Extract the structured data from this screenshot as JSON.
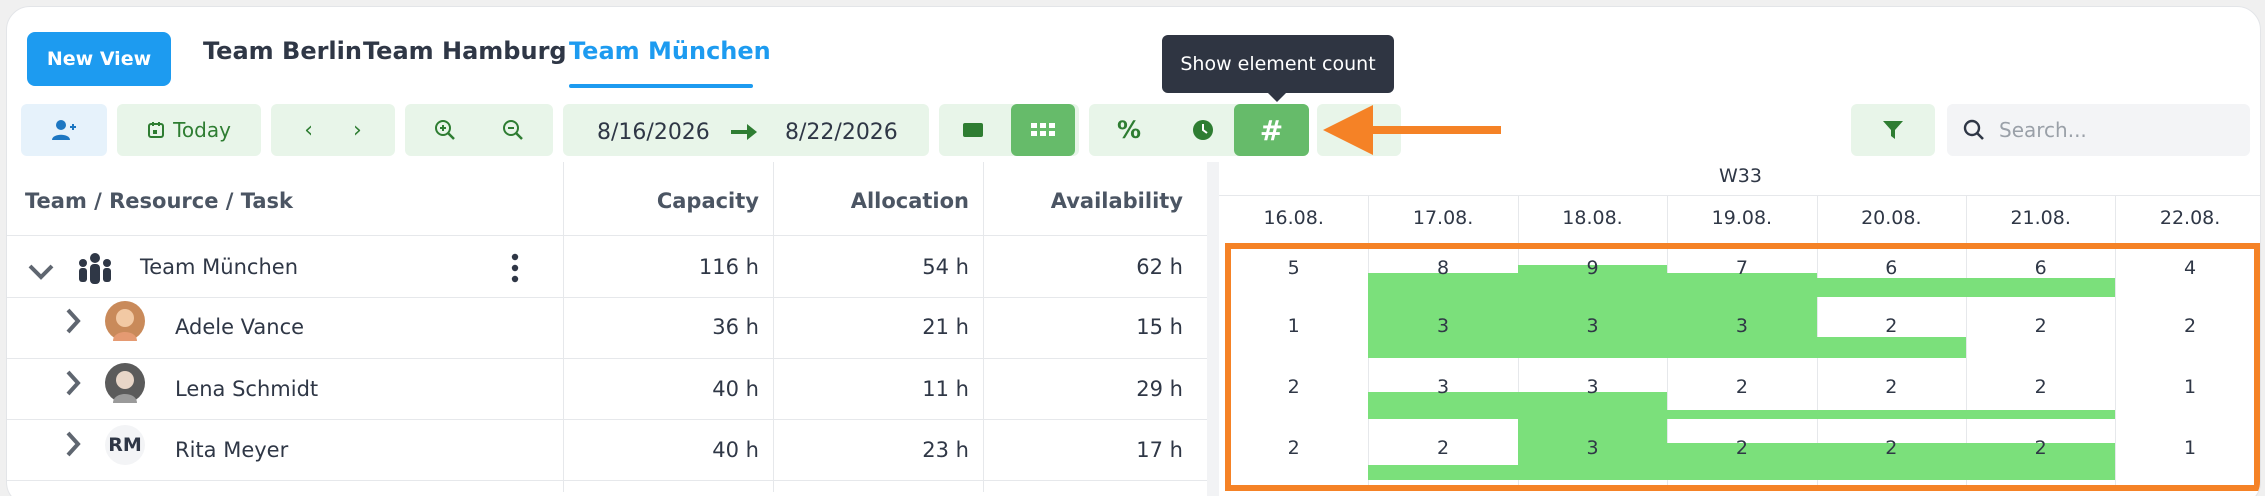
{
  "header": {
    "new_view_label": "New View",
    "tabs": [
      "Team Berlin",
      "Team Hamburg",
      "Team München"
    ],
    "active_tab_index": 2
  },
  "toolbar": {
    "today_label": "Today",
    "date_from": "8/16/2026",
    "date_to": "8/22/2026",
    "tooltip": "Show element count",
    "search_placeholder": "Search..."
  },
  "table": {
    "columns": [
      "Team / Resource / Task",
      "Capacity",
      "Allocation",
      "Availability"
    ],
    "group": {
      "name": "Team München",
      "capacity": "116 h",
      "allocation": "54 h",
      "availability": "62 h"
    },
    "rows": [
      {
        "name": "Adele Vance",
        "avatar": "photo",
        "capacity": "36 h",
        "allocation": "21 h",
        "availability": "15 h"
      },
      {
        "name": "Lena Schmidt",
        "avatar": "photo",
        "capacity": "40 h",
        "allocation": "11 h",
        "availability": "29 h"
      },
      {
        "name": "Rita Meyer",
        "avatar": "RM",
        "capacity": "40 h",
        "allocation": "23 h",
        "availability": "17 h"
      }
    ]
  },
  "timeline": {
    "week": "W33",
    "days": [
      "16.08.",
      "17.08.",
      "18.08.",
      "19.08.",
      "20.08.",
      "21.08.",
      "22.08."
    ],
    "counts": [
      [
        "5",
        "8",
        "9",
        "7",
        "6",
        "6",
        "4"
      ],
      [
        "1",
        "3",
        "3",
        "3",
        "2",
        "2",
        "2"
      ],
      [
        "2",
        "3",
        "3",
        "2",
        "2",
        "2",
        "1"
      ],
      [
        "2",
        "2",
        "3",
        "2",
        "2",
        "2",
        "1"
      ]
    ],
    "load_fraction": [
      [
        0,
        0.45,
        0.6,
        0.45,
        0.35,
        0.35,
        0
      ],
      [
        0,
        1.0,
        1.0,
        1.0,
        0.35,
        0,
        0
      ],
      [
        0,
        0.45,
        0.45,
        0.15,
        0.15,
        0.15,
        0
      ],
      [
        0,
        0.25,
        1.0,
        0.6,
        0.6,
        0.6,
        0
      ]
    ],
    "bar_color": "#7be07b",
    "highlight_color": "#f58226"
  }
}
